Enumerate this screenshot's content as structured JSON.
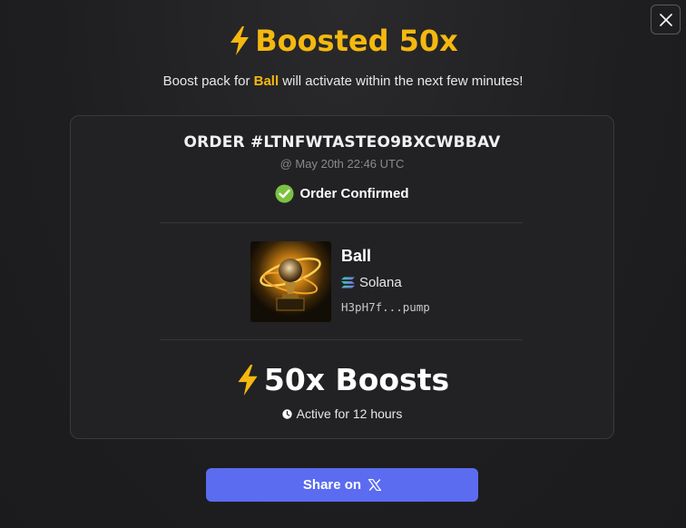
{
  "header": {
    "title": "Boosted 50x",
    "subtitle_prefix": "Boost pack for ",
    "subtitle_token": "Ball",
    "subtitle_suffix": " will activate within the next few minutes!"
  },
  "order": {
    "id": "ORDER #LTNFWTASTEO9BXCWBBAV",
    "time": "@ May 20th 22:46 UTC",
    "status": "Order Confirmed"
  },
  "token": {
    "name": "Ball",
    "chain": "Solana",
    "address": "H3pH7f...pump"
  },
  "boost": {
    "label": "50x Boosts",
    "duration": "Active for 12 hours"
  },
  "share": {
    "label": "Share on"
  },
  "colors": {
    "accent": "#f5b80f",
    "button": "#5b6cf0",
    "success": "#7cc242"
  },
  "icons": [
    "close-icon",
    "lightning-icon",
    "check-circle-icon",
    "solana-icon",
    "clock-icon",
    "x-logo-icon"
  ]
}
